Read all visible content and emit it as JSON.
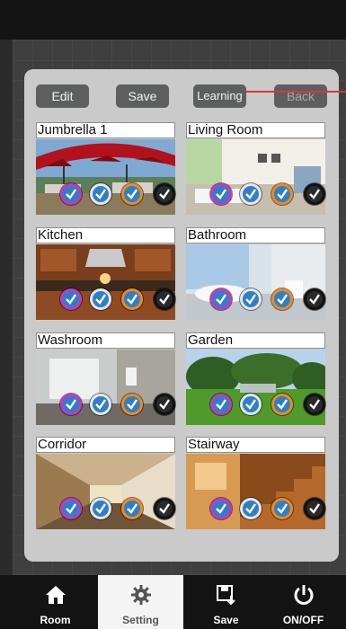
{
  "toolbar": {
    "edit_label": "Edit",
    "save_label": "Save",
    "learning_label": "Learning",
    "back_label": "Back"
  },
  "rooms": [
    {
      "label": "Jumbrella 1"
    },
    {
      "label": "Living Room"
    },
    {
      "label": "Kitchen"
    },
    {
      "label": "Bathroom"
    },
    {
      "label": "Washroom"
    },
    {
      "label": "Garden"
    },
    {
      "label": "Corridor"
    },
    {
      "label": "Stairway"
    }
  ],
  "nav": {
    "room_label": "Room",
    "setting_label": "Setting",
    "save_label": "Save",
    "onoff_label": "ON/OFF"
  },
  "colors": {
    "panel": "#c9cac9",
    "button": "#5d5f5f",
    "pointer": "#e0323a",
    "badge_fill": "#2e7fc9"
  }
}
